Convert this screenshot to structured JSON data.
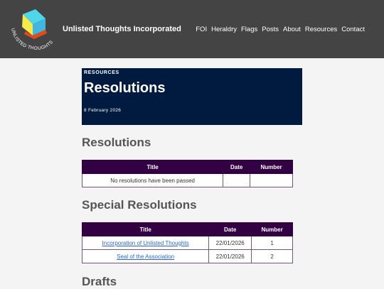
{
  "header": {
    "logo_text": "UNLISTED THOUGHTS",
    "site_title": "Unlisted Thoughts Incorporated",
    "nav": [
      "FOI",
      "Heraldry",
      "Flags",
      "Posts",
      "About",
      "Resources",
      "Contact"
    ]
  },
  "hero": {
    "kicker": "RESOURCES",
    "title": "Resolutions",
    "date": "8 February 2026"
  },
  "sections": {
    "resolutions": {
      "heading": "Resolutions",
      "columns": [
        "Title",
        "Date",
        "Number"
      ],
      "empty_text": "No resolutions have been passed"
    },
    "special": {
      "heading": "Special Resolutions",
      "columns": [
        "Title",
        "Date",
        "Number"
      ],
      "rows": [
        {
          "title": "Incorporation of Unlisted Thoughts",
          "date": "22/01/2026",
          "number": "1"
        },
        {
          "title": "Seal of the Association",
          "date": "22/01/2026",
          "number": "2"
        }
      ]
    },
    "drafts": {
      "heading": "Drafts"
    }
  },
  "colors": {
    "header_bg": "#444444",
    "hero_bg": "#001a40",
    "table_header_bg": "#330044",
    "link": "#2a66c8"
  }
}
